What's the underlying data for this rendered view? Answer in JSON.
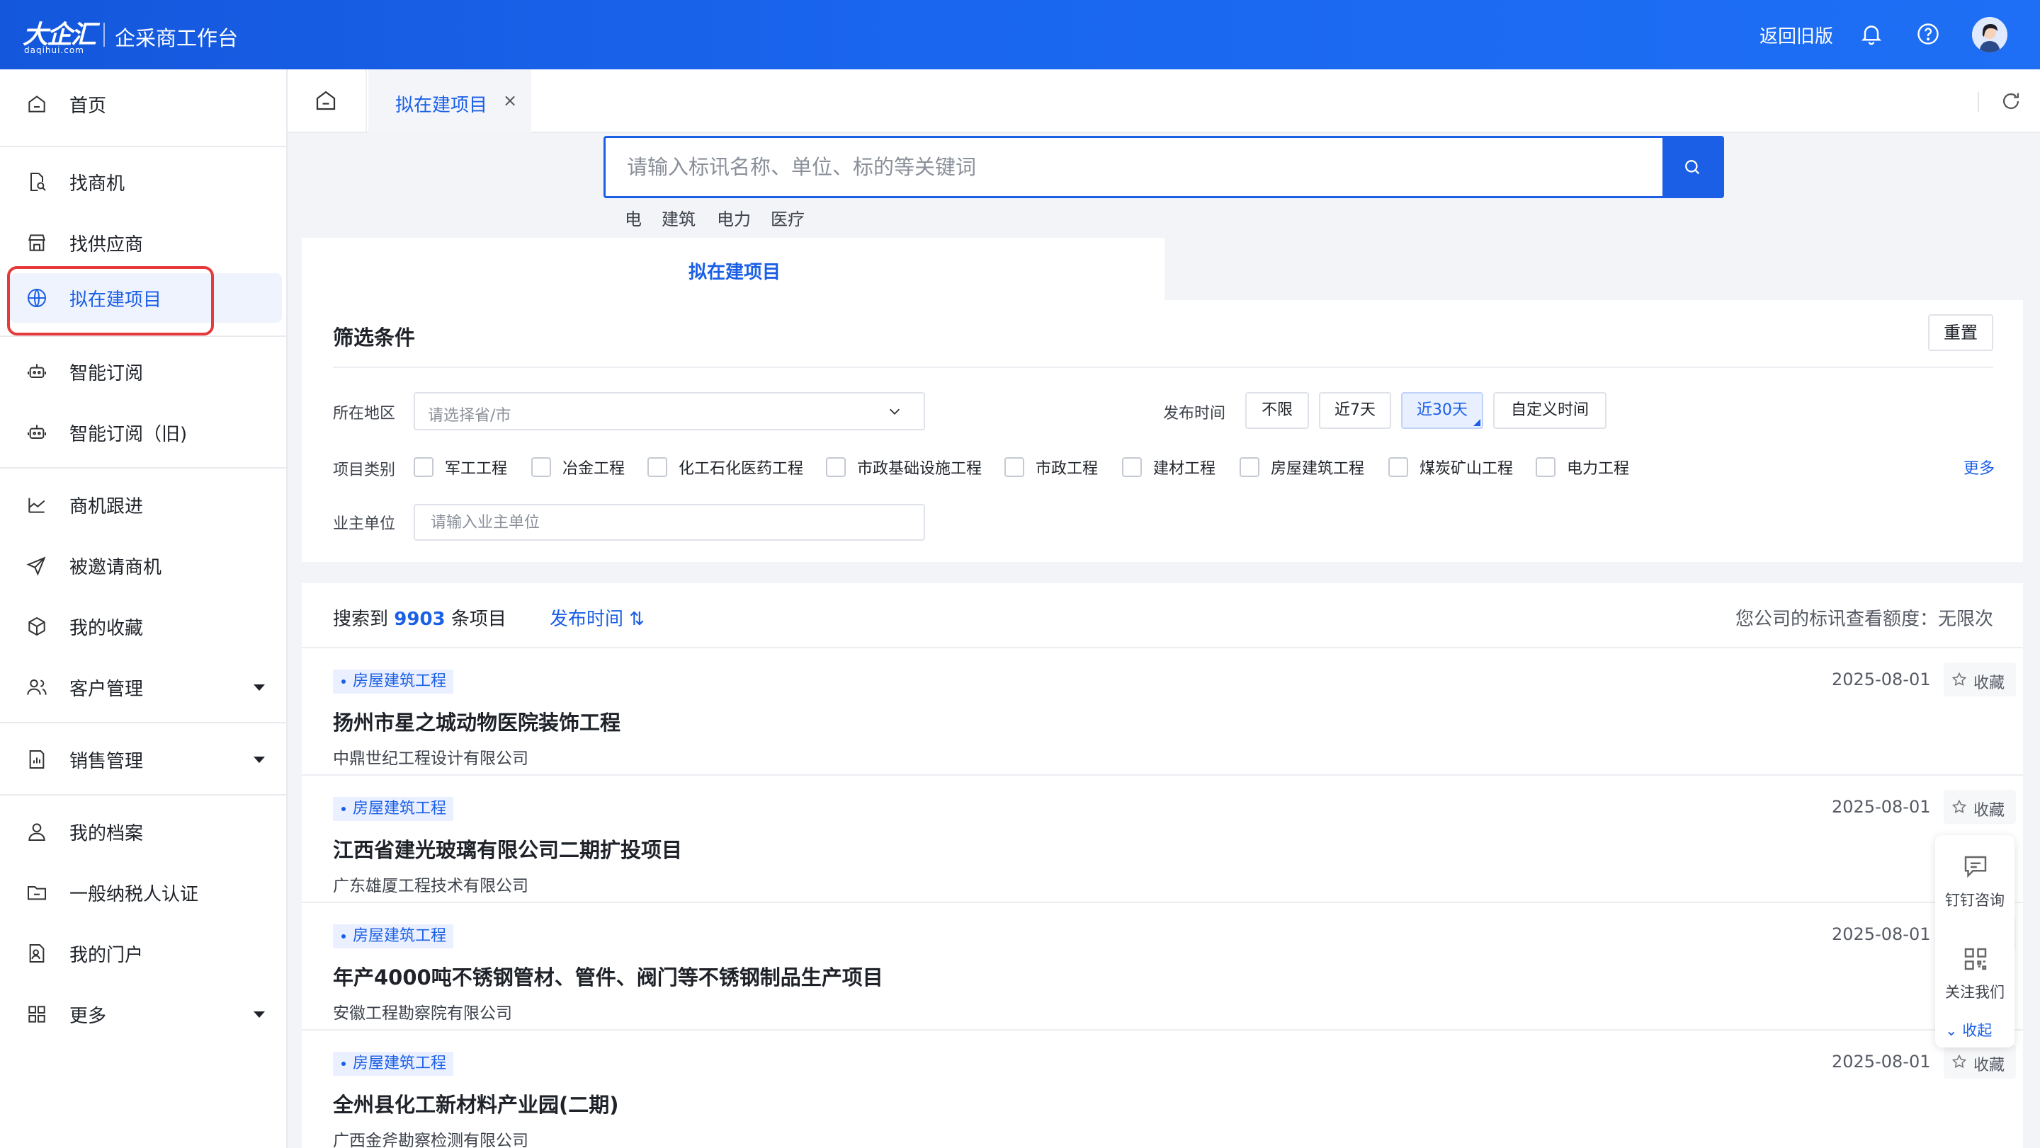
{
  "header": {
    "logo_text": "大企汇",
    "logo_domain": "daqihui.com",
    "app_title": "企采商工作台",
    "return_old_label": "返回旧版",
    "bell_icon": "bell-icon",
    "help_icon": "help-icon",
    "brand_color": "#1b5fe6"
  },
  "sidebar": {
    "items": [
      {
        "label": "首页",
        "icon": "home-icon"
      },
      {
        "label": "找商机",
        "icon": "document-search-icon"
      },
      {
        "label": "找供应商",
        "icon": "store-icon"
      },
      {
        "label": "拟在建项目",
        "icon": "globe-icon"
      },
      {
        "label": "智能订阅",
        "icon": "robot-icon"
      },
      {
        "label": "智能订阅（旧)",
        "icon": "robot-icon"
      },
      {
        "label": "商机跟进",
        "icon": "chart-icon"
      },
      {
        "label": "被邀请商机",
        "icon": "send-icon"
      },
      {
        "label": "我的收藏",
        "icon": "box-icon"
      },
      {
        "label": "客户管理",
        "icon": "users-icon"
      },
      {
        "label": "销售管理",
        "icon": "report-icon"
      },
      {
        "label": "我的档案",
        "icon": "user-icon"
      },
      {
        "label": "一般纳税人认证",
        "icon": "folder-icon"
      },
      {
        "label": "我的门户",
        "icon": "portal-icon"
      },
      {
        "label": "更多",
        "icon": "grid-icon"
      }
    ]
  },
  "tabs": {
    "active_label": "拟在建项目",
    "close_symbol": "×"
  },
  "search": {
    "placeholder": "请输入标讯名称、单位、标的等关键词",
    "hot_words": [
      "电",
      "建筑",
      "电力",
      "医疗"
    ]
  },
  "section_tab": "拟在建项目",
  "filter": {
    "title": "筛选条件",
    "reset_label": "重置",
    "region_label": "所在地区",
    "region_placeholder": "请选择省/市",
    "time_label": "发布时间",
    "time_options": [
      "不限",
      "近7天",
      "近30天",
      "自定义时间"
    ],
    "time_selected": "近30天",
    "category_label": "项目类别",
    "categories": [
      "军工工程",
      "冶金工程",
      "化工石化医药工程",
      "市政基础设施工程",
      "市政工程",
      "建材工程",
      "房屋建筑工程",
      "煤炭矿山工程",
      "电力工程"
    ],
    "more_label": "更多",
    "owner_label": "业主单位",
    "owner_placeholder": "请输入业主单位"
  },
  "results": {
    "count_prefix": "搜索到",
    "count": "9903",
    "count_suffix": "条项目",
    "sort_label": "发布时间 ⇅",
    "quota_text": "您公司的标讯查看额度：无限次",
    "fav_label": "收藏",
    "items": [
      {
        "tag": "房屋建筑工程",
        "title": "扬州市星之城动物医院装饰工程",
        "unit": "中鼎世纪工程设计有限公司",
        "date": "2025-08-01"
      },
      {
        "tag": "房屋建筑工程",
        "title": "江西省建光玻璃有限公司二期扩投项目",
        "unit": "广东雄厦工程技术有限公司",
        "date": "2025-08-01"
      },
      {
        "tag": "房屋建筑工程",
        "title": "年产4000吨不锈钢管材、管件、阀门等不锈钢制品生产项目",
        "unit": "安徽工程勘察院有限公司",
        "date": "2025-08-01"
      },
      {
        "tag": "房屋建筑工程",
        "title": "全州县化工新材料产业园(二期)",
        "unit": "广西金斧勘察检测有限公司",
        "date": "2025-08-01"
      }
    ]
  },
  "float_widget": {
    "consult_label": "钉钉咨询",
    "follow_label": "关注我们",
    "collapse_label": "收起"
  }
}
